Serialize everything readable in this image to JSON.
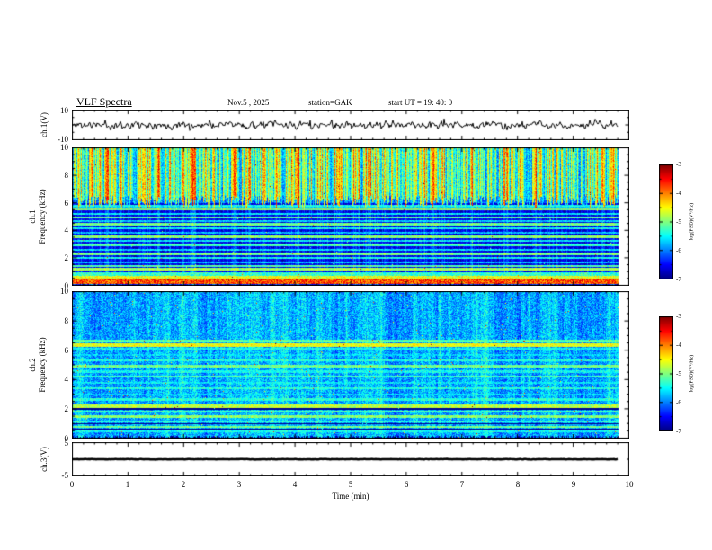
{
  "header": {
    "title": "VLF  Spectra",
    "date_label": "Nov.5  , 2025",
    "station_label": "station=GAK",
    "start_label": "start UT =   19: 40: 0"
  },
  "time_axis": {
    "label": "Time  (min)",
    "ticks": [
      "0",
      "1",
      "2",
      "3",
      "4",
      "5",
      "6",
      "7",
      "8",
      "9",
      "10"
    ],
    "range_min": [
      0,
      10
    ],
    "data_end_min": 9.8
  },
  "panels": {
    "ch1_wave": {
      "ylabel": "ch.1(V)",
      "yticks": [
        "10",
        "-10"
      ],
      "ylim": [
        -10,
        10
      ]
    },
    "ch1_spec": {
      "ylabel_line1": "ch.1",
      "ylabel_line2": "Frequency (kHz)",
      "yticks": [
        "10",
        "8",
        "6",
        "4",
        "2",
        "0"
      ],
      "ylim": [
        0,
        10
      ]
    },
    "ch2_spec": {
      "ylabel_line1": "ch.2",
      "ylabel_line2": "Frequency (kHz)",
      "yticks": [
        "10",
        "8",
        "6",
        "4",
        "2",
        "0"
      ],
      "ylim": [
        0,
        10
      ]
    },
    "ch3_wave": {
      "ylabel": "ch.3(V)",
      "yticks": [
        "5",
        "-5"
      ],
      "ylim": [
        -5,
        5
      ]
    }
  },
  "colorbar": {
    "label": "log(PSD)(V²/Hz)",
    "ticks": [
      "-3",
      "-4",
      "-5",
      "-6",
      "-7"
    ],
    "range": [
      -7,
      -3
    ],
    "colormap": "jet"
  },
  "colors": {
    "background": "#ffffff",
    "frame": "#000000",
    "trace": "#000000"
  },
  "chart_data": [
    {
      "type": "line",
      "name": "ch1_waveform",
      "title": "ch.1 time series",
      "xlabel": "Time (min)",
      "ylabel": "ch.1(V)",
      "xlim": [
        0,
        9.8
      ],
      "ylim": [
        -10,
        10
      ],
      "description": "Continuous broadband noise waveform centered on 0 V, typical amplitude ±2 V with frequent spikes to ±4 V, drawn in black over the full 0–9.8 min record.",
      "render": {
        "seed": 11,
        "sigma": 2.0,
        "smooth": 0.45,
        "spike_prob": 0.03,
        "spike_amp": 4.0,
        "thickness": 1
      }
    },
    {
      "type": "heatmap",
      "name": "ch1_spectrogram",
      "title": "ch.1 VLF spectrogram",
      "xlabel": "Time (min)",
      "ylabel": "Frequency (kHz)",
      "xlim": [
        0,
        9.8
      ],
      "ylim": [
        0,
        10
      ],
      "zlim": [
        -7,
        -3
      ],
      "zlabel": "log(PSD)(V²/Hz)",
      "colormap": "jet",
      "description": "Above ~6 kHz: dense vertical burst striations reaching green/yellow/orange (-4.5 to -3.5). Below 6 kHz: dark blue/black background (-6.8) crossed by many narrow horizontal enhanced lines (-6 to -5). Strong orange band near 0.2-0.5 kHz (-3.8) with weaker green bands just above it.",
      "render": {
        "seed": 42,
        "background": [
          {
            "f0": 6.0,
            "f1": 10.0,
            "v": -6.2,
            "noise": 0.35
          },
          {
            "f0": 1.05,
            "f1": 6.0,
            "v": -6.75,
            "noise": 0.25
          },
          {
            "f0": 0.0,
            "f1": 1.05,
            "v": -6.6,
            "noise": 0.3
          }
        ],
        "stripe": {
          "fmin": 5.6,
          "fmax": 10,
          "gain": 3.0,
          "low_gain": 0.9,
          "persist": 0.35,
          "bright_prob": 0.5,
          "edge_jitter": 0.9
        },
        "lines": [
          {
            "f": 5.75,
            "w": 0.07,
            "v": -5.6
          },
          {
            "f": 5.5,
            "w": 0.07,
            "v": -5.1
          },
          {
            "f": 5.2,
            "w": 0.09,
            "v": -5.7
          },
          {
            "f": 4.95,
            "w": 0.07,
            "v": -5.3
          },
          {
            "f": 4.7,
            "w": 0.07,
            "v": -5.8
          },
          {
            "f": 4.45,
            "w": 0.07,
            "v": -5.2
          },
          {
            "f": 4.15,
            "w": 0.09,
            "v": -5.6
          },
          {
            "f": 3.85,
            "w": 0.07,
            "v": -5.9
          },
          {
            "f": 3.55,
            "w": 0.08,
            "v": -5.1
          },
          {
            "f": 3.25,
            "w": 0.07,
            "v": -5.7
          },
          {
            "f": 2.95,
            "w": 0.08,
            "v": -5.4
          },
          {
            "f": 2.6,
            "w": 0.07,
            "v": -5.8
          },
          {
            "f": 2.3,
            "w": 0.08,
            "v": -5.2
          },
          {
            "f": 2.0,
            "w": 0.07,
            "v": -5.6
          },
          {
            "f": 1.7,
            "w": 0.07,
            "v": -5.9
          },
          {
            "f": 1.45,
            "w": 0.07,
            "v": -5.3
          },
          {
            "f": 1.2,
            "w": 0.08,
            "v": -5.0
          }
        ],
        "dark_lines": [],
        "bands": [
          {
            "f0": 0.15,
            "f1": 0.5,
            "v": -3.8,
            "noise": 0.5
          },
          {
            "f0": 0.5,
            "f1": 0.72,
            "v": -4.6,
            "noise": 0.4
          },
          {
            "f0": 0.72,
            "f1": 0.95,
            "v": -5.3,
            "noise": 0.35
          }
        ],
        "speckle": {
          "prob": 0.002,
          "gain": 1.5
        }
      }
    },
    {
      "type": "heatmap",
      "name": "ch2_spectrogram",
      "title": "ch.2 VLF spectrogram",
      "xlabel": "Time (min)",
      "ylabel": "Frequency (kHz)",
      "xlim": [
        0,
        9.8
      ],
      "ylim": [
        0,
        10
      ],
      "zlim": [
        -7,
        -3
      ],
      "zlabel": "log(PSD)(V²/Hz)",
      "colormap": "jet",
      "description": "Mostly blue background (-6.5 to -5) modulated by full-height vertical stripes; horizontal green line near 6.35 kHz (-4.7), strong cyan band near 2.2 kHz (-4.9), many weaker cyan/blue lines between 0.5 and 6.6 kHz; dark lines near 2.0 and 1.0 kHz; scattered green speckles.",
      "render": {
        "seed": 77,
        "background": [
          {
            "f0": 0.35,
            "f1": 10,
            "v": -6.45,
            "noise": 0.35
          },
          {
            "f0": 0.0,
            "f1": 0.35,
            "v": -6.85,
            "noise": 0.2
          }
        ],
        "stripe": {
          "fmin": 0.0,
          "fmax": 10,
          "gain": 1.35,
          "low_gain": 0.0,
          "persist": 0.75,
          "bright_prob": 0.45,
          "edge_jitter": 0.2
        },
        "lines": [
          {
            "f": 6.6,
            "w": 0.08,
            "v": -5.3
          },
          {
            "f": 6.35,
            "w": 0.1,
            "v": -4.7
          },
          {
            "f": 6.1,
            "w": 0.07,
            "v": -5.6
          },
          {
            "f": 5.65,
            "w": 0.07,
            "v": -5.8
          },
          {
            "f": 5.3,
            "w": 0.07,
            "v": -5.5
          },
          {
            "f": 4.9,
            "w": 0.08,
            "v": -5.2
          },
          {
            "f": 4.55,
            "w": 0.07,
            "v": -5.6
          },
          {
            "f": 4.2,
            "w": 0.07,
            "v": -5.4
          },
          {
            "f": 3.8,
            "w": 0.07,
            "v": -5.7
          },
          {
            "f": 3.4,
            "w": 0.07,
            "v": -5.5
          },
          {
            "f": 3.0,
            "w": 0.07,
            "v": -5.8
          },
          {
            "f": 2.65,
            "w": 0.07,
            "v": -5.5
          },
          {
            "f": 2.2,
            "w": 0.14,
            "v": -4.9
          },
          {
            "f": 1.85,
            "w": 0.07,
            "v": -5.4
          },
          {
            "f": 1.5,
            "w": 0.08,
            "v": -5.1
          },
          {
            "f": 1.15,
            "w": 0.07,
            "v": -5.5
          },
          {
            "f": 0.8,
            "w": 0.08,
            "v": -5.2
          },
          {
            "f": 0.5,
            "w": 0.07,
            "v": -5.6
          }
        ],
        "dark_lines": [
          {
            "f": 2.02,
            "w": 0.05
          },
          {
            "f": 1.0,
            "w": 0.05
          },
          {
            "f": 0.62,
            "w": 0.04
          }
        ],
        "bands": [],
        "speckle": {
          "prob": 0.004,
          "gain": 1.6
        }
      }
    },
    {
      "type": "line",
      "name": "ch3_waveform",
      "title": "ch.3 time series",
      "xlabel": "Time (min)",
      "ylabel": "ch.3(V)",
      "xlim": [
        0,
        9.8
      ],
      "ylim": [
        -5,
        5
      ],
      "description": "Flat constant 0 V trace (no signal), drawn as a thick black line across the full 0–9.8 min record.",
      "render": {
        "seed": 3,
        "sigma": 0.06,
        "smooth": 0.5,
        "spike_prob": 0,
        "spike_amp": 0,
        "thickness": 2.5
      }
    }
  ]
}
